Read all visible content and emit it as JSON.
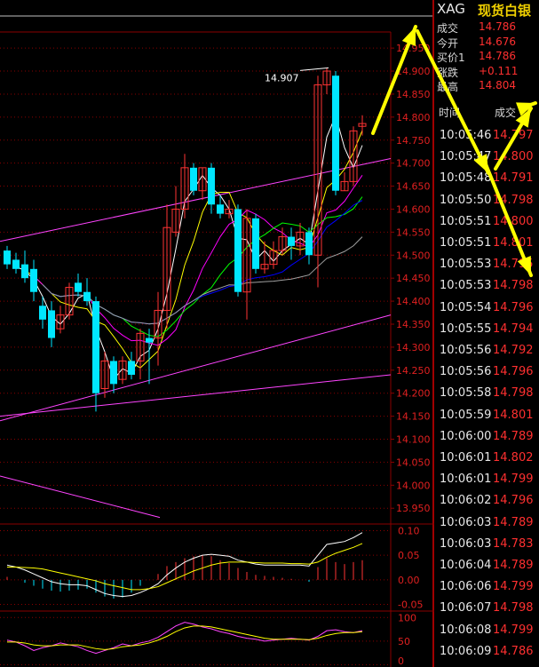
{
  "symbol": {
    "code": "XAG",
    "name": "现货白银"
  },
  "quote": [
    {
      "label": "成交",
      "value": "14.786"
    },
    {
      "label": "今开",
      "value": "14.676"
    },
    {
      "label": "买价1",
      "value": "14.786"
    },
    {
      "label": "涨跌",
      "value": "+0.111"
    },
    {
      "label": "最高",
      "value": "14.804"
    }
  ],
  "ticks_header": {
    "time": "时间",
    "price": "成交"
  },
  "ticks": [
    {
      "time": "10:05:46",
      "price": "14.797"
    },
    {
      "time": "10:05:47",
      "price": "14.800"
    },
    {
      "time": "10:05:48",
      "price": "14.791"
    },
    {
      "time": "10:05:50",
      "price": "14.798"
    },
    {
      "time": "10:05:51",
      "price": "14.800"
    },
    {
      "time": "10:05:51",
      "price": "14.801"
    },
    {
      "time": "10:05:53",
      "price": "14.795"
    },
    {
      "time": "10:05:53",
      "price": "14.798"
    },
    {
      "time": "10:05:54",
      "price": "14.796"
    },
    {
      "time": "10:05:55",
      "price": "14.794"
    },
    {
      "time": "10:05:56",
      "price": "14.792"
    },
    {
      "time": "10:05:56",
      "price": "14.796"
    },
    {
      "time": "10:05:58",
      "price": "14.798"
    },
    {
      "time": "10:05:59",
      "price": "14.801"
    },
    {
      "time": "10:06:00",
      "price": "14.789"
    },
    {
      "time": "10:06:01",
      "price": "14.802"
    },
    {
      "time": "10:06:01",
      "price": "14.799"
    },
    {
      "time": "10:06:02",
      "price": "14.796"
    },
    {
      "time": "10:06:03",
      "price": "14.789"
    },
    {
      "time": "10:06:03",
      "price": "14.783"
    },
    {
      "time": "10:06:04",
      "price": "14.789"
    },
    {
      "time": "10:06:06",
      "price": "14.799"
    },
    {
      "time": "10:06:07",
      "price": "14.798"
    },
    {
      "time": "10:06:08",
      "price": "14.799"
    },
    {
      "time": "10:06:09",
      "price": "14.786"
    }
  ],
  "colors": {
    "up": "#ff3333",
    "down": "#00e6ff",
    "grid": "#8a0000",
    "ma1": "#ffffff",
    "ma2": "#ffff00",
    "ma3": "#ff00ff",
    "ma4": "#00ff00",
    "ma5": "#0000ff",
    "ma6": "#a0a0a0",
    "arrow": "#ffff00"
  },
  "chart_data": {
    "type": "candlestick",
    "max_label": "14.907",
    "price_axis": [
      "14.950",
      "14.900",
      "14.850",
      "14.800",
      "14.750",
      "14.700",
      "14.650",
      "14.600",
      "14.550",
      "14.500",
      "14.450",
      "14.400",
      "14.350",
      "14.300",
      "14.250",
      "14.200",
      "14.150",
      "14.100",
      "14.050",
      "14.000",
      "13.950"
    ],
    "ylim": [
      13.935,
      14.985
    ],
    "candles": [
      [
        14.51,
        14.48,
        14.52,
        14.47
      ],
      [
        14.49,
        14.47,
        14.505,
        14.46
      ],
      [
        14.48,
        14.45,
        14.51,
        14.44
      ],
      [
        14.47,
        14.42,
        14.49,
        14.4
      ],
      [
        14.39,
        14.36,
        14.41,
        14.34
      ],
      [
        14.38,
        14.32,
        14.4,
        14.3
      ],
      [
        14.34,
        14.37,
        14.39,
        14.33
      ],
      [
        14.37,
        14.43,
        14.44,
        14.36
      ],
      [
        14.44,
        14.42,
        14.46,
        14.41
      ],
      [
        14.42,
        14.4,
        14.45,
        14.39
      ],
      [
        14.4,
        14.2,
        14.41,
        14.16
      ],
      [
        14.21,
        14.27,
        14.29,
        14.19
      ],
      [
        14.27,
        14.22,
        14.28,
        14.2
      ],
      [
        14.23,
        14.27,
        14.28,
        14.22
      ],
      [
        14.27,
        14.24,
        14.29,
        14.23
      ],
      [
        14.27,
        14.33,
        14.34,
        14.23
      ],
      [
        14.32,
        14.31,
        14.34,
        14.22
      ],
      [
        14.32,
        14.38,
        14.42,
        14.26
      ],
      [
        14.38,
        14.56,
        14.61,
        14.34
      ],
      [
        14.55,
        14.6,
        14.65,
        14.54
      ],
      [
        14.6,
        14.69,
        14.72,
        14.58
      ],
      [
        14.69,
        14.64,
        14.7,
        14.63
      ],
      [
        14.64,
        14.69,
        14.69,
        14.62
      ],
      [
        14.69,
        14.61,
        14.7,
        14.59
      ],
      [
        14.61,
        14.59,
        14.63,
        14.58
      ],
      [
        14.59,
        14.6,
        14.62,
        14.58
      ],
      [
        14.6,
        14.42,
        14.61,
        14.41
      ],
      [
        14.42,
        14.58,
        14.6,
        14.36
      ],
      [
        14.58,
        14.47,
        14.59,
        14.46
      ],
      [
        14.47,
        14.48,
        14.53,
        14.46
      ],
      [
        14.48,
        14.51,
        14.53,
        14.47
      ],
      [
        14.51,
        14.54,
        14.56,
        14.5
      ],
      [
        14.54,
        14.52,
        14.56,
        14.49
      ],
      [
        14.52,
        14.55,
        14.57,
        14.5
      ],
      [
        14.55,
        14.5,
        14.56,
        14.48
      ],
      [
        14.5,
        14.87,
        14.89,
        14.43
      ],
      [
        14.87,
        14.9,
        14.907,
        14.85
      ],
      [
        14.89,
        14.64,
        14.9,
        14.63
      ],
      [
        14.64,
        14.66,
        14.68,
        14.64
      ],
      [
        14.66,
        14.77,
        14.78,
        14.65
      ],
      [
        14.78,
        14.786,
        14.804,
        14.76
      ]
    ],
    "indicator1": {
      "ticks": [
        "0.10",
        "0.05",
        "0.00",
        "-0.05"
      ],
      "ylim": [
        -0.06,
        0.11
      ],
      "dif": [
        0.03,
        0.026,
        0.02,
        0.012,
        0.004,
        -0.004,
        -0.008,
        -0.01,
        -0.01,
        -0.012,
        -0.02,
        -0.028,
        -0.032,
        -0.034,
        -0.032,
        -0.026,
        -0.018,
        -0.008,
        0.01,
        0.024,
        0.036,
        0.044,
        0.05,
        0.052,
        0.05,
        0.048,
        0.04,
        0.036,
        0.032,
        0.03,
        0.03,
        0.03,
        0.03,
        0.03,
        0.028,
        0.05,
        0.072,
        0.075,
        0.078,
        0.086,
        0.096
      ],
      "dea": [
        0.026,
        0.026,
        0.025,
        0.024,
        0.022,
        0.018,
        0.014,
        0.01,
        0.006,
        0.002,
        -0.002,
        -0.008,
        -0.012,
        -0.016,
        -0.02,
        -0.02,
        -0.018,
        -0.014,
        -0.006,
        0.002,
        0.01,
        0.018,
        0.024,
        0.03,
        0.034,
        0.036,
        0.036,
        0.036,
        0.035,
        0.034,
        0.034,
        0.034,
        0.033,
        0.033,
        0.032,
        0.036,
        0.046,
        0.054,
        0.06,
        0.066,
        0.074
      ],
      "hist": [
        0.006,
        0.0,
        -0.006,
        -0.012,
        -0.018,
        -0.022,
        -0.024,
        -0.022,
        -0.02,
        -0.018,
        -0.026,
        -0.034,
        -0.038,
        -0.036,
        -0.026,
        -0.012,
        0.0,
        0.012,
        0.028,
        0.036,
        0.044,
        0.048,
        0.05,
        0.048,
        0.04,
        0.034,
        0.024,
        0.016,
        0.01,
        0.008,
        0.006,
        0.004,
        0.002,
        0.0,
        -0.004,
        0.026,
        0.044,
        0.036,
        0.032,
        0.036,
        0.04
      ]
    },
    "indicator2": {
      "ticks": [
        "100",
        "50",
        "0"
      ],
      "ylim": [
        -5,
        110
      ],
      "k": [
        52,
        48,
        40,
        30,
        36,
        40,
        46,
        42,
        38,
        30,
        24,
        30,
        36,
        44,
        40,
        46,
        50,
        58,
        70,
        82,
        90,
        86,
        80,
        76,
        70,
        66,
        60,
        56,
        54,
        50,
        52,
        54,
        56,
        54,
        52,
        60,
        72,
        74,
        70,
        68,
        72
      ],
      "d": [
        48,
        48,
        46,
        42,
        40,
        40,
        42,
        42,
        42,
        38,
        34,
        32,
        34,
        38,
        40,
        42,
        46,
        52,
        60,
        70,
        78,
        82,
        82,
        80,
        76,
        72,
        68,
        64,
        60,
        56,
        54,
        54,
        54,
        54,
        53,
        56,
        62,
        66,
        68,
        68,
        70
      ]
    }
  }
}
